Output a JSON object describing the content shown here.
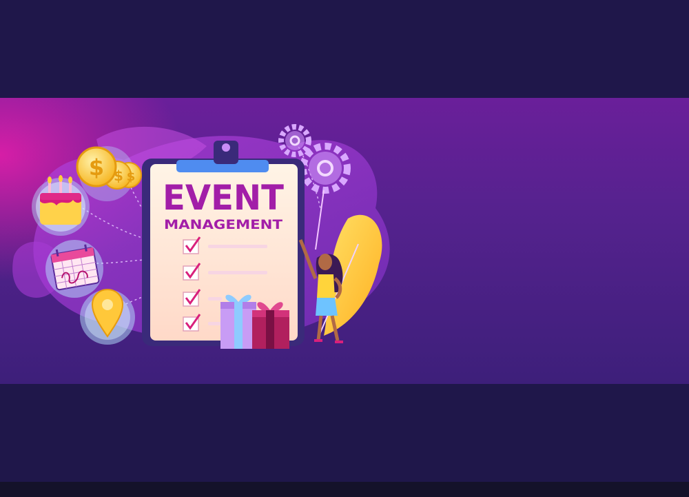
{
  "illustration": {
    "title_line1": "EVENT",
    "title_line2": "MANAGEMENT",
    "checklist_items": 4,
    "icons": [
      "dollar-coin-icon",
      "birthday-cake-icon",
      "calendar-icon",
      "location-pin-icon",
      "gear-icon",
      "gift-box-icon",
      "woman-figure-icon"
    ],
    "colors": {
      "background_dark": "#1f174a",
      "accent_pink": "#eb1eaa",
      "accent_purple": "#6a1f9a",
      "clipboard_paper": "#ffe9d0",
      "title_magenta": "#a21ea8",
      "coin_yellow": "#ffd43b"
    }
  }
}
